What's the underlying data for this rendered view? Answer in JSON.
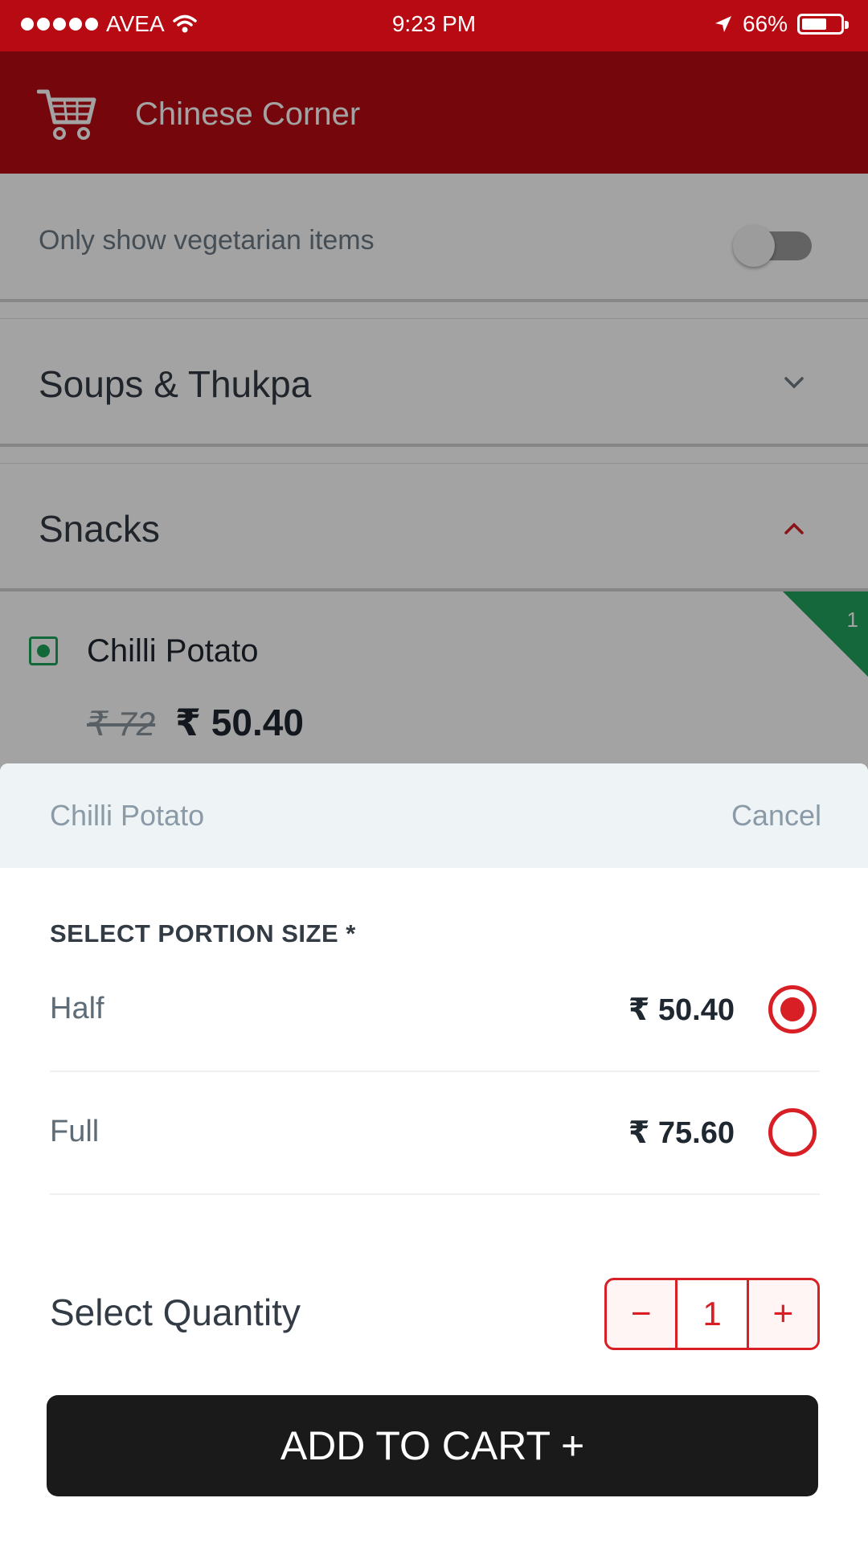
{
  "status_bar": {
    "carrier": "AVEA",
    "time": "9:23 PM",
    "battery_percent": "66%",
    "battery_level": 0.66,
    "icons": [
      "signal-dots-icon",
      "wifi-icon",
      "location-arrow-icon",
      "battery-icon"
    ]
  },
  "app_bar": {
    "title": "Chinese Corner",
    "icon": "shopping-cart-icon"
  },
  "filters": {
    "veg_only_label": "Only show vegetarian items",
    "veg_only_enabled": false
  },
  "menu": {
    "categories": [
      {
        "name": "Soups & Thukpa",
        "expanded": false,
        "chevron": "chevron-down-icon"
      },
      {
        "name": "Snacks",
        "expanded": true,
        "chevron": "chevron-up-icon"
      }
    ],
    "dish": {
      "name": "Chilli Potato",
      "original_price": "₹ 72",
      "discounted_price": "₹ 50.40",
      "cart_count": "1",
      "is_vegetarian": true
    }
  },
  "sheet": {
    "title": "Chilli Potato",
    "cancel_label": "Cancel",
    "portion_heading": "SELECT PORTION SIZE *",
    "options": [
      {
        "label": "Half",
        "price": "₹ 50.40",
        "selected": true
      },
      {
        "label": "Full",
        "price": "₹ 75.60",
        "selected": false
      }
    ],
    "quantity_label": "Select Quantity",
    "quantity_value": "1",
    "decrement_symbol": "−",
    "increment_symbol": "+",
    "add_to_cart_label": "ADD TO CART +"
  },
  "colors": {
    "brand_red": "#b80a12",
    "accent_red": "#d81f26",
    "veg_green": "#1fa35a",
    "button_dark": "#1a1a1a"
  }
}
